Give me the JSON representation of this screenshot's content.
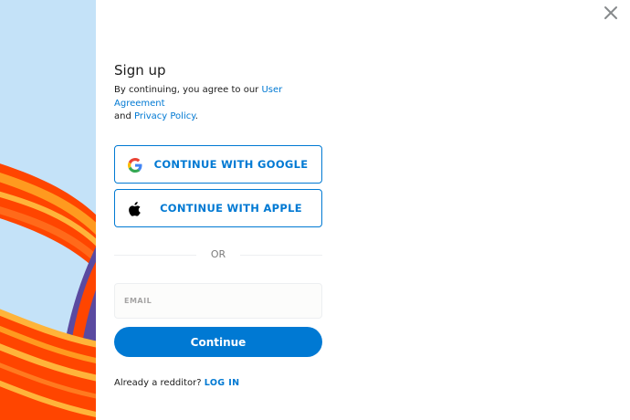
{
  "close": {
    "icon": "close-icon"
  },
  "signup": {
    "title": "Sign up",
    "terms_prefix": "By continuing, you agree to our ",
    "user_agreement_link": "User Agreement",
    "terms_middle": "and ",
    "privacy_link": "Privacy Policy",
    "terms_suffix": "."
  },
  "oauth": {
    "google_label": "CONTINUE WITH GOOGLE",
    "google_icon": "google-logo-icon",
    "apple_label": "CONTINUE WITH APPLE",
    "apple_icon": "apple-logo-icon"
  },
  "divider": {
    "label": "OR"
  },
  "email": {
    "placeholder": "EMAIL",
    "value": ""
  },
  "continue_button": {
    "label": "Continue"
  },
  "login": {
    "prompt": "Already a redditor? ",
    "link": "LOG IN"
  },
  "colors": {
    "accent": "#0079d3",
    "text": "#1c1c1c",
    "muted": "#7c7c7c",
    "side_background": "#c4e2f8"
  }
}
